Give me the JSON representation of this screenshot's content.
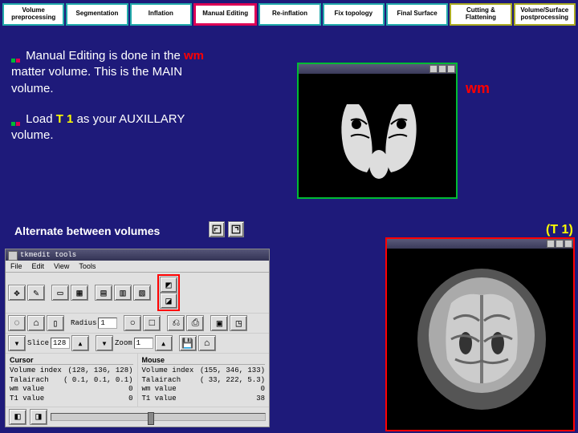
{
  "pipeline": [
    {
      "label": "Volume preprocessing",
      "style": "teal"
    },
    {
      "label": "Segmentation",
      "style": "teal"
    },
    {
      "label": "Inflation",
      "style": "teal"
    },
    {
      "label": "Manual Editing",
      "style": "magenta"
    },
    {
      "label": "Re-inflation",
      "style": "teal"
    },
    {
      "label": "Fix topology",
      "style": "teal"
    },
    {
      "label": "Final Surface",
      "style": "teal"
    },
    {
      "label": "Cutting & Flattening",
      "style": "olive"
    },
    {
      "label": "Volume/Surface postprocessing",
      "style": "olive"
    }
  ],
  "bullets": {
    "b1_pre": "Manual Editing is done in the ",
    "b1_em": "wm",
    "b1_post": " matter volume.  This is the MAIN volume.",
    "b2_pre": "Load ",
    "b2_em": "T 1",
    "b2_post": " as your AUXILLARY volume."
  },
  "alt_label": "Alternate between volumes",
  "labels": {
    "wm": "wm",
    "t1": "(T 1)"
  },
  "toolbox": {
    "title": "tkmedit tools",
    "menu": [
      "File",
      "Edit",
      "View",
      "Tools"
    ],
    "radius_label": "Radius",
    "radius_value": "1",
    "slice_label": "Slice",
    "slice_value": "128",
    "zoom_label": "Zoom",
    "zoom_value": "1",
    "cursor_title": "Cursor",
    "mouse_title": "Mouse",
    "rows": [
      {
        "k": "Volume index",
        "c": "(128, 136, 128)",
        "m": "(155, 346, 133)"
      },
      {
        "k": "Talairach",
        "c": "( 0.1, 0.1, 0.1)",
        "m": "( 33, 222, 5.3)"
      },
      {
        "k": "wm value",
        "c": "0",
        "m": "0"
      },
      {
        "k": "T1 value",
        "c": "0",
        "m": "38"
      }
    ]
  }
}
